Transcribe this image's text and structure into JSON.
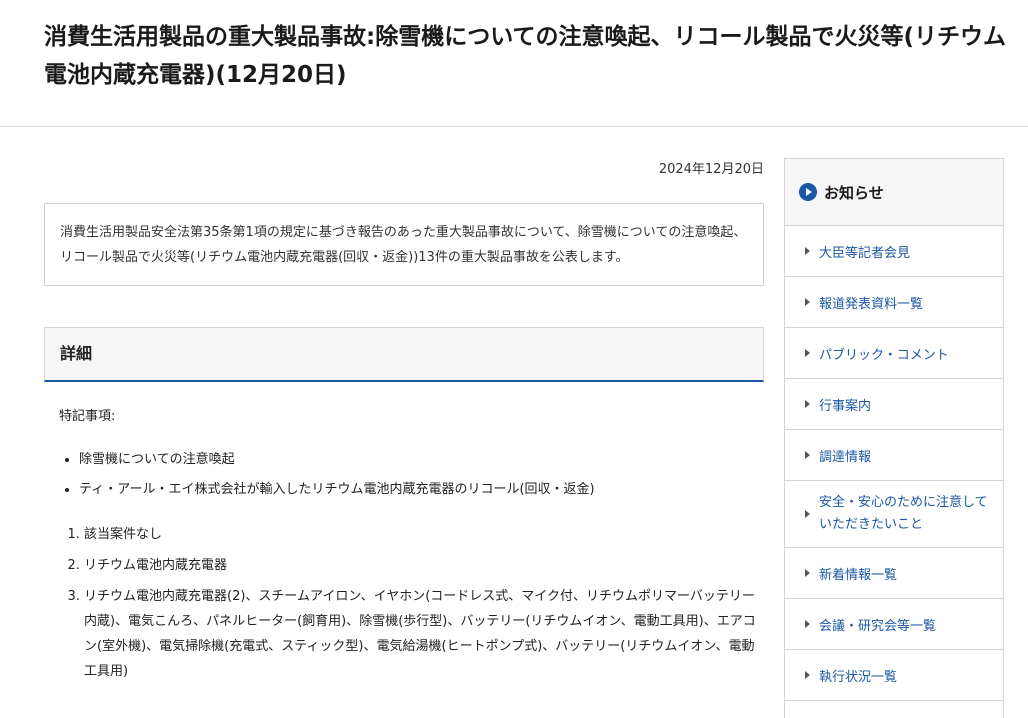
{
  "header": {
    "title": "消費生活用製品の重大製品事故:除雪機についての注意喚起、リコール製品で火災等(リチウム電池内蔵充電器)(12月20日)"
  },
  "main": {
    "date": "2024年12月20日",
    "summary": "消費生活用製品安全法第35条第1項の規定に基づき報告のあった重大製品事故について、除雪機についての注意喚起、リコール製品で火災等(リチウム電池内蔵充電器(回収・返金))13件の重大製品事故を公表します。",
    "detail_heading": "詳細",
    "notes_label": "特記事項:",
    "bullets": [
      "除雪機についての注意喚起",
      "ティ・アール・エイ株式会社が輸入したリチウム電池内蔵充電器のリコール(回収・返金)"
    ],
    "numbered": [
      "該当案件なし",
      "リチウム電池内蔵充電器",
      "リチウム電池内蔵充電器(2)、スチームアイロン、イヤホン(コードレス式、マイク付、リチウムポリマーバッテリー内蔵)、電気こんろ、パネルヒーター(飼育用)、除雪機(歩行型)、バッテリー(リチウムイオン、電動工具用)、エアコン(室外機)、電気掃除機(充電式、スティック型)、電気給湯機(ヒートポンプ式)、バッテリー(リチウムイオン、電動工具用)"
    ]
  },
  "sidebar": {
    "heading": "お知らせ",
    "items": [
      {
        "label": "大臣等記者会見"
      },
      {
        "label": "報道発表資料一覧"
      },
      {
        "label": "パブリック・コメント"
      },
      {
        "label": "行事案内"
      },
      {
        "label": "調達情報"
      },
      {
        "label": "安全・安心のために注意していただきたいこと"
      },
      {
        "label": "新着情報一覧"
      },
      {
        "label": "会議・研究会等一覧"
      },
      {
        "label": "執行状況一覧"
      }
    ]
  },
  "colors": {
    "accent": "#1c57a3",
    "border": "#d4d4d4"
  }
}
